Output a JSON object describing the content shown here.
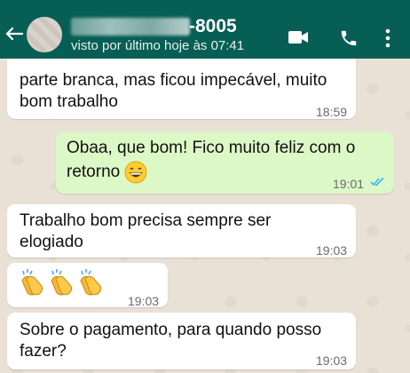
{
  "header": {
    "contact_name_visible": "-8005",
    "status": "visto por último hoje às 07:41",
    "icons": [
      "back-arrow-icon",
      "video-call-icon",
      "phone-icon",
      "more-vertical-icon"
    ],
    "colors": {
      "bar": "#075e54",
      "icon": "#ffffff"
    }
  },
  "messages": [
    {
      "direction": "in",
      "text_line1": "parte branca, mas ficou impecável, muito",
      "text_line2": "bom trabalho",
      "time": "18:59"
    },
    {
      "direction": "out",
      "text_line1": "Obaa, que bom! Fico muito feliz com o",
      "text_line2": "retorno",
      "emoji": "grinning-face-icon",
      "time": "19:01",
      "status": "read"
    },
    {
      "direction": "in",
      "text_line1": "Trabalho bom precisa sempre ser",
      "text_line2": "elogiado",
      "time": "19:03"
    },
    {
      "direction": "in",
      "emoji": "clapping-hands-icon",
      "emoji_count": 3,
      "time": "19:03"
    },
    {
      "direction": "in",
      "text_line1": "Sobre o pagamento, para quando posso",
      "text_line2": "fazer?",
      "time": "19:03"
    }
  ],
  "colors": {
    "incoming_bubble": "#ffffff",
    "outgoing_bubble": "#dcf8c6",
    "read_ticks": "#34b7f1",
    "chat_bg": "#e9e1d6"
  }
}
